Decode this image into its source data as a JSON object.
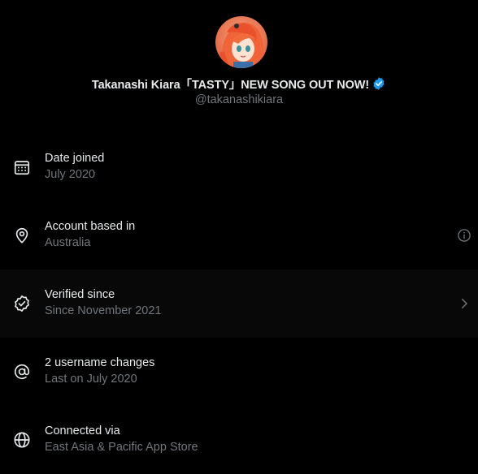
{
  "profile": {
    "display_name": "Takanashi Kiara「TASTY」NEW SONG OUT NOW!",
    "handle": "@takanashikiara",
    "verified": true,
    "avatar": "avatar-illustration",
    "accent_color": "#1d9bf0"
  },
  "rows": [
    {
      "icon": "calendar-icon",
      "title": "Date joined",
      "subtitle": "July 2020",
      "trailing": null
    },
    {
      "icon": "location-pin-icon",
      "title": "Account based in",
      "subtitle": "Australia",
      "trailing": "info-icon"
    },
    {
      "icon": "verified-check-icon",
      "title": "Verified since",
      "subtitle": "Since November 2021",
      "trailing": "chevron-right-icon"
    },
    {
      "icon": "at-sign-icon",
      "title": "2 username changes",
      "subtitle": "Last on July 2020",
      "trailing": null
    },
    {
      "icon": "globe-icon",
      "title": "Connected via",
      "subtitle": "East Asia & Pacific App Store",
      "trailing": null
    }
  ],
  "colors": {
    "background": "#000000",
    "primary_text": "#e7e9ea",
    "secondary_text": "#71767b",
    "verified_badge": "#1d9bf0"
  }
}
